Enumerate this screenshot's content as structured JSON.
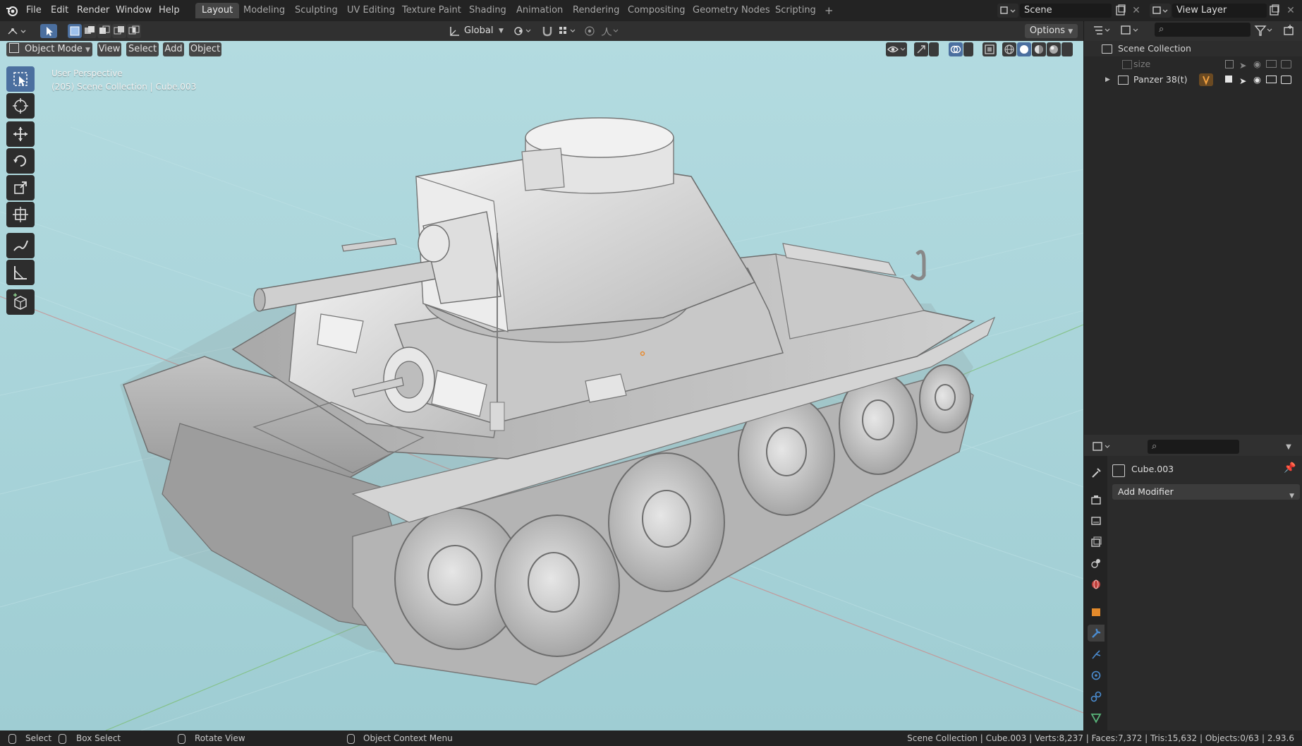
{
  "menu": {
    "items": [
      "File",
      "Edit",
      "Render",
      "Window",
      "Help"
    ]
  },
  "workspaces": {
    "tabs": [
      "Layout",
      "Modeling",
      "Sculpting",
      "UV Editing",
      "Texture Paint",
      "Shading",
      "Animation",
      "Rendering",
      "Compositing",
      "Geometry Nodes",
      "Scripting"
    ],
    "add_label": "+"
  },
  "scene": {
    "name": "Scene"
  },
  "view_layer": {
    "name": "View Layer"
  },
  "header": {
    "mode": "Object Mode",
    "view": "View",
    "select": "Select",
    "add": "Add",
    "object": "Object",
    "orientation": "Global",
    "options": "Options"
  },
  "viewport": {
    "perspective": "User Perspective",
    "context": "(205) Scene Collection | Cube.003"
  },
  "outliner": {
    "root": "Scene Collection",
    "items": [
      {
        "name": "size",
        "dimmed": true
      },
      {
        "name": "Panzer 38(t)",
        "dimmed": false
      }
    ]
  },
  "properties": {
    "object_name": "Cube.003",
    "add_modifier": "Add Modifier"
  },
  "status": {
    "select": "Select",
    "box_select": "Box Select",
    "rotate_view": "Rotate View",
    "context_menu": "Object Context Menu",
    "stats": "Scene Collection | Cube.003 | Verts:8,237 | Faces:7,372 | Tris:15,632 | Objects:0/63 | 2.93.6"
  },
  "colors": {
    "accent": "#4b6f9f",
    "viewport_bg": "#a8d4d9",
    "panel": "#282828",
    "modifier_icon": "#4b8cd0",
    "object_icon": "#e38a2b"
  }
}
